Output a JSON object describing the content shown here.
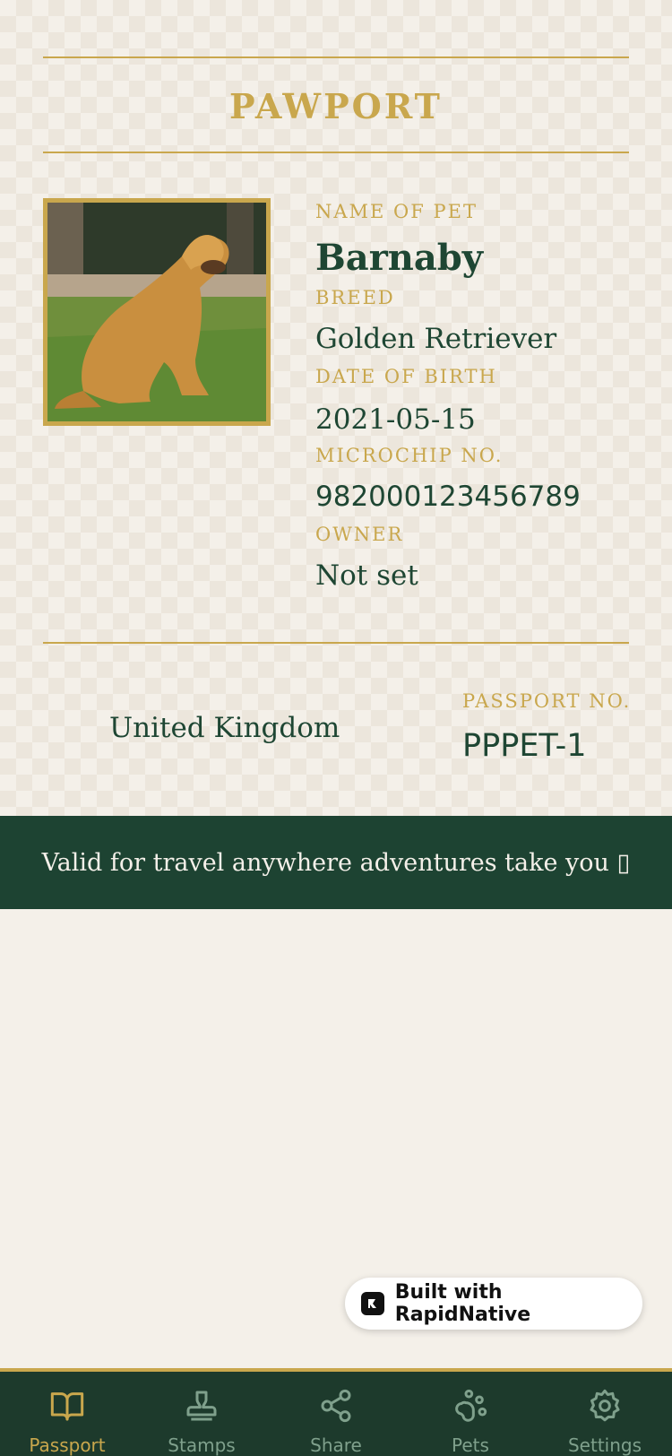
{
  "app": {
    "title": "PAWPORT"
  },
  "pet": {
    "name_label": "NAME OF PET",
    "name": "Barnaby",
    "breed_label": "BREED",
    "breed": "Golden Retriever",
    "dob_label": "DATE OF BIRTH",
    "dob": "2021-05-15",
    "microchip_label": "MICROCHIP NO.",
    "microchip": "982000123456789",
    "owner_label": "OWNER",
    "owner": "Not set"
  },
  "passport": {
    "country": "United Kingdom",
    "number_label": "PASSPORT NO.",
    "number": "PPPET-1"
  },
  "banner": {
    "text": "Valid for travel anywhere adventures take you ▯"
  },
  "badge": {
    "text": "Built with RapidNative"
  },
  "tabs": [
    {
      "label": "Passport",
      "icon": "book-open-icon",
      "active": true
    },
    {
      "label": "Stamps",
      "icon": "stamp-icon",
      "active": false
    },
    {
      "label": "Share",
      "icon": "share-icon",
      "active": false
    },
    {
      "label": "Pets",
      "icon": "paw-icon",
      "active": false
    },
    {
      "label": "Settings",
      "icon": "gear-icon",
      "active": false
    }
  ],
  "colors": {
    "gold": "#c9a74d",
    "green": "#1d4332",
    "cream": "#f4f0e9"
  }
}
